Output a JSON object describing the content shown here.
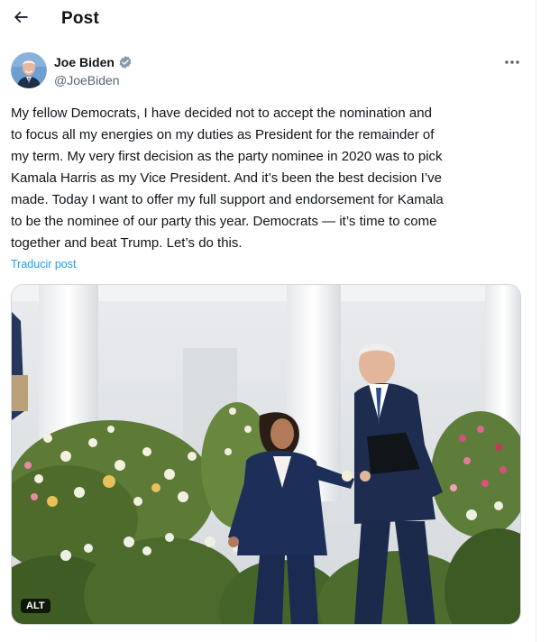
{
  "header": {
    "title": "Post",
    "back_icon": "arrow-left-icon"
  },
  "author": {
    "name": "Joe Biden",
    "handle": "@JoeBiden",
    "verified_icon": "verified-badge-icon",
    "verified_color": "#829aab"
  },
  "post": {
    "lines": [
      "My fellow Democrats, I have decided not to accept the nomination and",
      "to focus all my energies on my duties as President for the remainder of",
      "my term. My very first decision as the party nominee in 2020 was to pick",
      "Kamala Harris as my Vice President. And it’s been the best decision I’ve",
      "made. Today I want to offer my full support and endorsement for Kamala",
      "to be the nominee of our party this year. Democrats — it’s time to come",
      "together and beat Trump. Let’s do this."
    ],
    "translate_label": "Traducir post"
  },
  "media": {
    "alt_label": "ALT"
  },
  "colors": {
    "accent": "#1d9bf0",
    "secondary_text": "#536471",
    "border": "#cfd9de"
  }
}
